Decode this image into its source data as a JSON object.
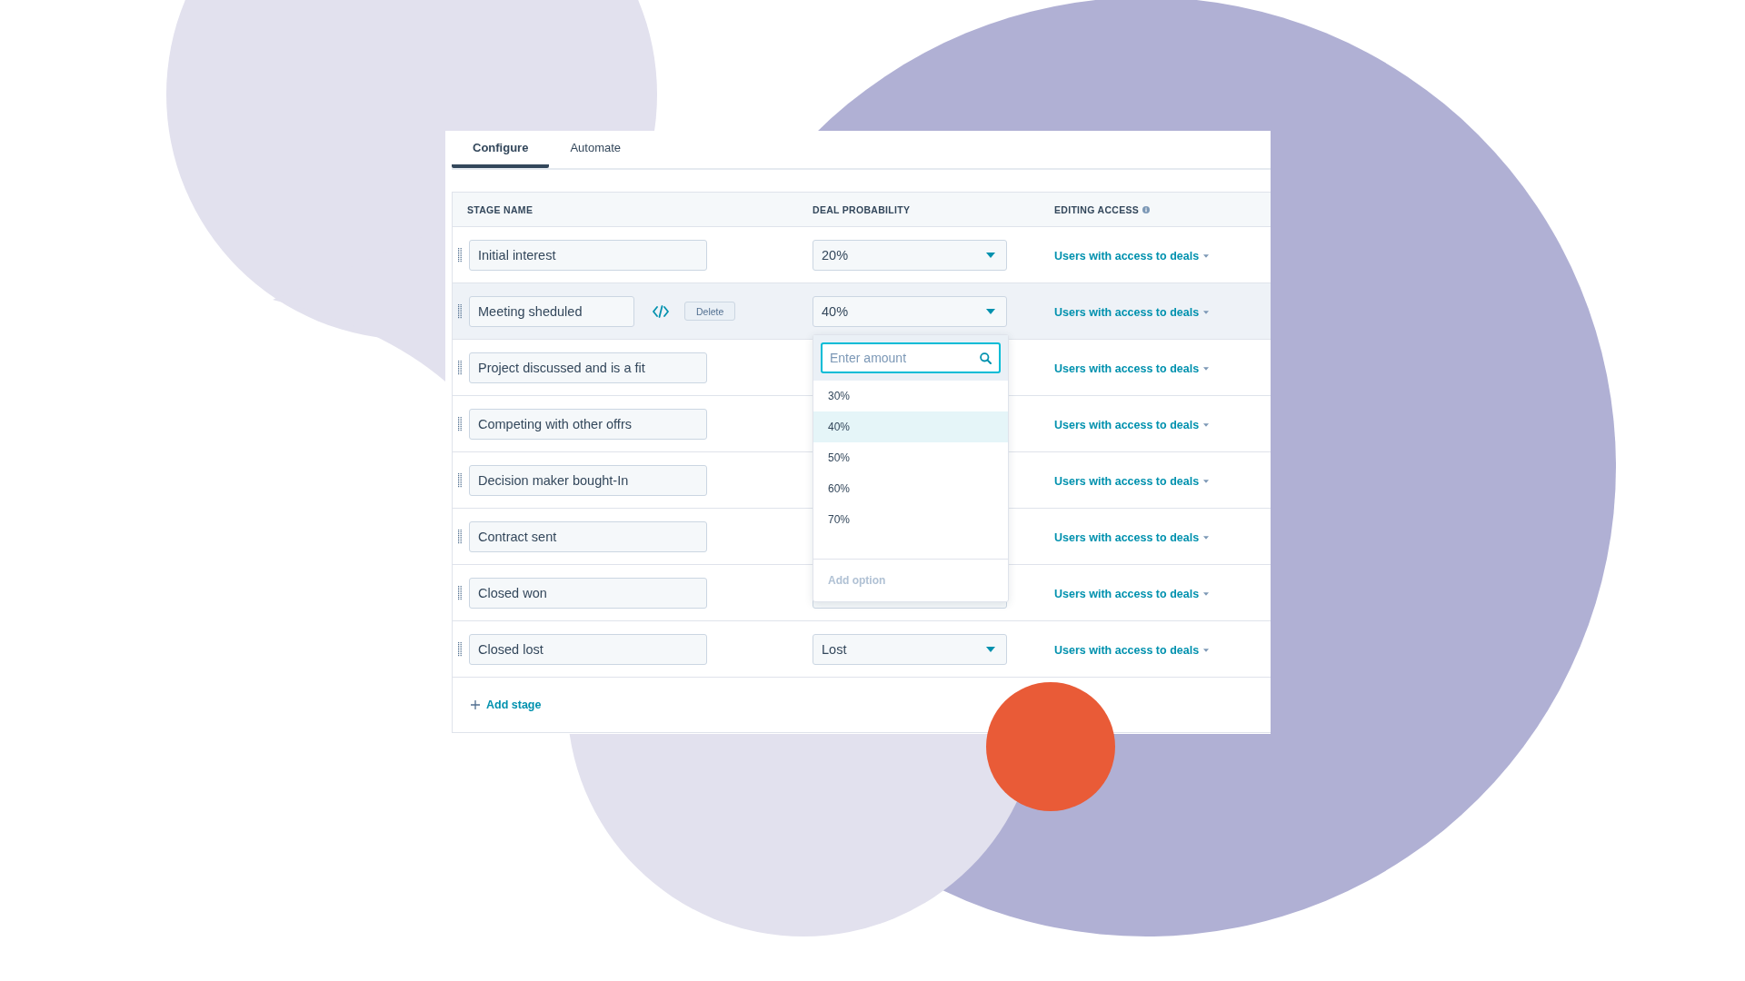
{
  "tabs": [
    {
      "label": "Configure",
      "selected": true
    },
    {
      "label": "Automate",
      "selected": false
    }
  ],
  "table": {
    "columns": [
      "STAGE NAME",
      "DEAL PROBABILITY",
      "EDITING ACCESS"
    ],
    "rows": [
      {
        "stage": "Initial interest",
        "probability": "20%",
        "access": "Users with access to deals",
        "highlighted": false
      },
      {
        "stage": "Meeting sheduled",
        "probability": "40%",
        "access": "Users with access to deals",
        "highlighted": true,
        "delete_label": "Delete",
        "probability_menu": {
          "placeholder": "Enter amount",
          "options": [
            {
              "label": "30%",
              "selected": false
            },
            {
              "label": "40%",
              "selected": true
            },
            {
              "label": "50%",
              "selected": false
            },
            {
              "label": "60%",
              "selected": false
            },
            {
              "label": "70%",
              "selected": false
            }
          ],
          "add_option": {
            "label": "Add option",
            "disabled": true
          }
        }
      },
      {
        "stage": "Project discussed and is a fit",
        "access": "Users with access to deals",
        "highlighted": false
      },
      {
        "stage": "Competing with other offrs",
        "access": "Users with access to deals",
        "highlighted": false
      },
      {
        "stage": "Decision maker bought-In",
        "access": "Users with access to deals",
        "highlighted": false
      },
      {
        "stage": "Contract sent",
        "access": "Users with access to deals",
        "highlighted": false
      },
      {
        "stage": "Closed won",
        "probability_select": true,
        "access": "Users with access to deals",
        "highlighted": false
      },
      {
        "stage": "Closed lost",
        "probability": "Lost",
        "access": "Users with access to deals",
        "highlighted": false
      }
    ]
  },
  "add_stage": "Add stage"
}
